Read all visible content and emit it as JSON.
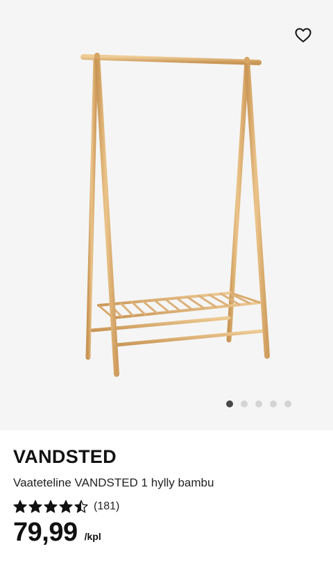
{
  "product": {
    "brand": "VANDSTED",
    "description": "Vaateteline VANDSTED 1 hylly bambu",
    "rating": {
      "value": 4.5,
      "max": 5,
      "count": "(181)"
    },
    "price": "79,99",
    "unit": "/kpl"
  },
  "gallery": {
    "image_count": 5,
    "active_index": 0,
    "image_subject": "bamboo clothes rack with one shelf"
  },
  "icons": {
    "favorite": "heart-outline-icon",
    "star": "star-icon"
  },
  "colors": {
    "image_background": "#f5f5f5",
    "bamboo": "#e2b679",
    "dot_active": "#484848",
    "dot_inactive": "#d4d4d4",
    "text": "#111111"
  }
}
